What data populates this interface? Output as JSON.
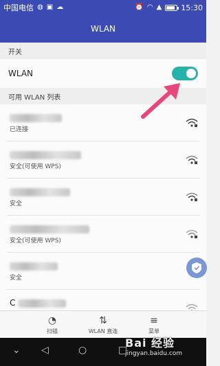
{
  "status_bar": {
    "carrier": "中国电信",
    "time": "15:30",
    "icons": [
      "sim-icon",
      "image-icon",
      "cloud-icon",
      "alarm-icon",
      "wifi-icon",
      "signal-icon",
      "battery-icon"
    ]
  },
  "header": {
    "title": "WLAN"
  },
  "switch_section": {
    "label": "开关"
  },
  "wlan_toggle": {
    "label": "WLAN",
    "enabled": true,
    "color": "#27b1ab"
  },
  "available_section": {
    "label": "可用 WLAN 列表"
  },
  "networks": [
    {
      "status": "已连接",
      "wifi_icon": "wifi-secured-icon"
    },
    {
      "status": "安全(可使用 WPS)",
      "wifi_icon": "wifi-secured-icon"
    },
    {
      "status": "安全",
      "wifi_icon": "wifi-secured-icon"
    },
    {
      "status": "安全(可使用 WPS)",
      "wifi_icon": "wifi-secured-icon"
    },
    {
      "status": "安全",
      "wifi_icon": "wifi-secured-icon"
    },
    {
      "name_visible_prefix": "C",
      "wifi_icon": "wifi-secured-icon"
    }
  ],
  "bottom_nav": [
    {
      "label": "扫描",
      "icon": "scan-icon"
    },
    {
      "label": "WLAN 直连",
      "icon": "wifi-direct-icon"
    },
    {
      "label": "菜单",
      "icon": "menu-icon"
    }
  ],
  "system_nav": [
    "back-icon",
    "home-icon",
    "recents-icon"
  ],
  "watermark": {
    "text": "Bai 经验",
    "url": "jingyan.baidu.com"
  },
  "colors": {
    "accent": "#3b4bb3",
    "toggle": "#27b1ab",
    "arrow": "#e8457a"
  }
}
